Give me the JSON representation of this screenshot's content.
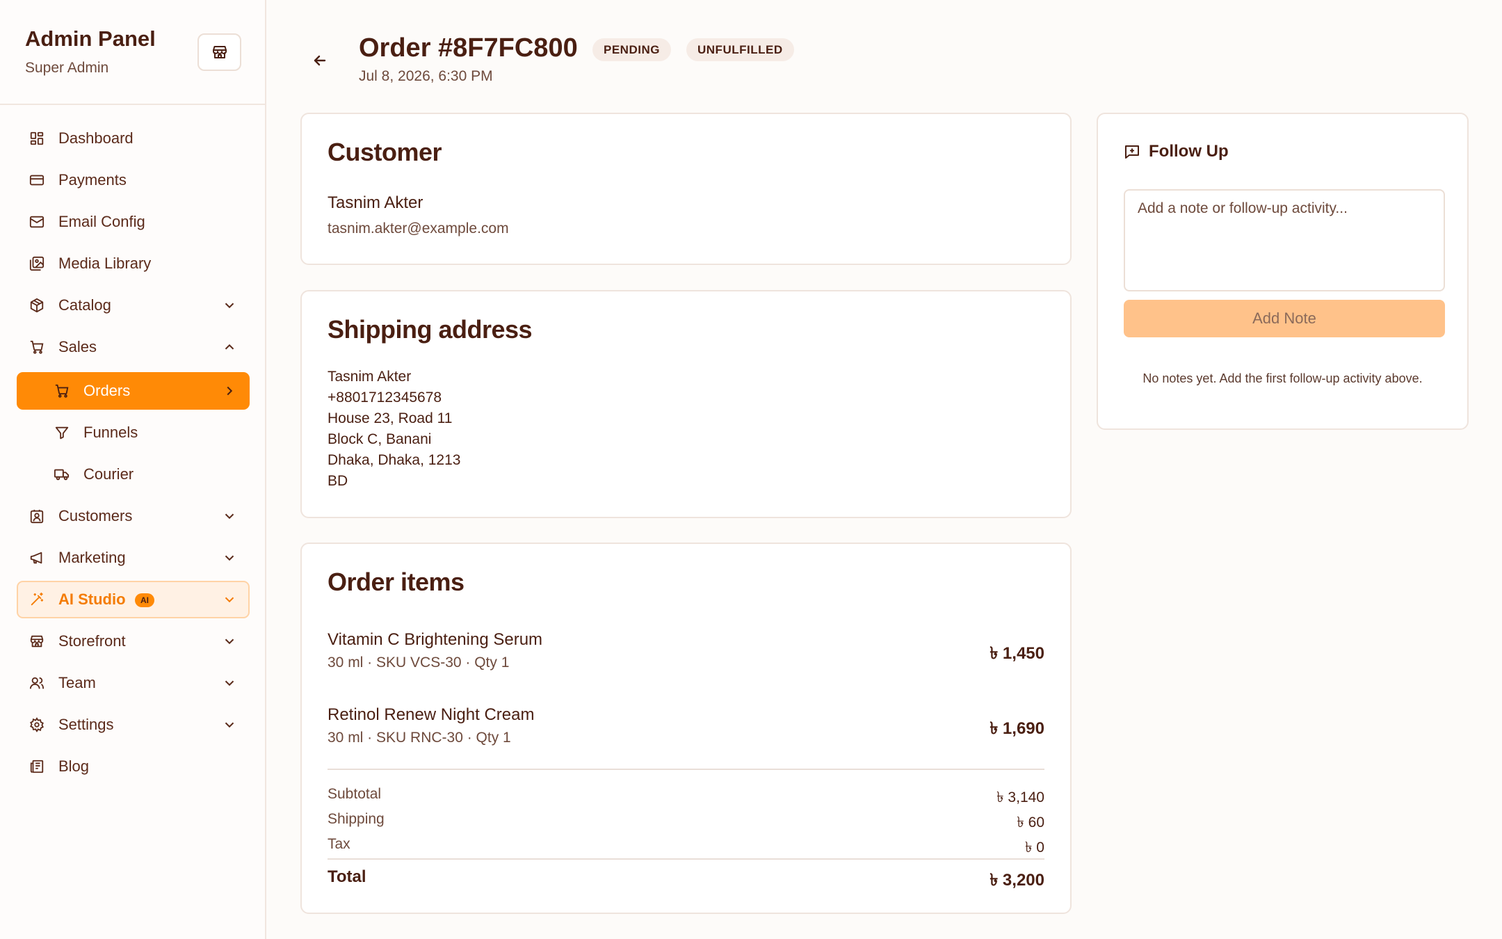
{
  "sidebar": {
    "title": "Admin Panel",
    "subtitle": "Super Admin",
    "items": [
      {
        "label": "Dashboard",
        "icon": "dashboard-icon"
      },
      {
        "label": "Payments",
        "icon": "credit-card-icon"
      },
      {
        "label": "Email Config",
        "icon": "mail-icon"
      },
      {
        "label": "Media Library",
        "icon": "images-icon"
      },
      {
        "label": "Catalog",
        "icon": "package-icon"
      },
      {
        "label": "Sales",
        "icon": "cart-icon"
      },
      {
        "label": "Orders",
        "icon": "cart-icon"
      },
      {
        "label": "Funnels",
        "icon": "funnel-icon"
      },
      {
        "label": "Courier",
        "icon": "truck-icon"
      },
      {
        "label": "Customers",
        "icon": "contact-icon"
      },
      {
        "label": "Marketing",
        "icon": "megaphone-icon"
      },
      {
        "label": "AI Studio",
        "icon": "wand-icon",
        "badge": "AI"
      },
      {
        "label": "Storefront",
        "icon": "store-icon"
      },
      {
        "label": "Team",
        "icon": "users-icon"
      },
      {
        "label": "Settings",
        "icon": "gear-icon"
      },
      {
        "label": "Blog",
        "icon": "newspaper-icon"
      }
    ]
  },
  "header": {
    "title": "Order #8F7FC800",
    "status_badge": "PENDING",
    "fulfillment_badge": "UNFULFILLED",
    "date": "Jul 8, 2026, 6:30 PM"
  },
  "customer": {
    "heading": "Customer",
    "name": "Tasnim Akter",
    "email": "tasnim.akter@example.com"
  },
  "shipping": {
    "heading": "Shipping address",
    "lines": [
      "Tasnim Akter",
      "+8801712345678",
      "House 23, Road 11",
      "Block C, Banani",
      "Dhaka, Dhaka, 1213",
      "BD"
    ]
  },
  "order_items": {
    "heading": "Order items",
    "items": [
      {
        "name": "Vitamin C Brightening Serum",
        "meta": "30 ml · SKU VCS-30 · Qty 1",
        "price": "৳ 1,450"
      },
      {
        "name": "Retinol Renew Night Cream",
        "meta": "30 ml · SKU RNC-30 · Qty 1",
        "price": "৳ 1,690"
      }
    ],
    "subtotal_label": "Subtotal",
    "subtotal": "৳ 3,140",
    "shipping_label": "Shipping",
    "shipping": "৳ 60",
    "tax_label": "Tax",
    "tax": "৳ 0",
    "total_label": "Total",
    "total": "৳ 3,200"
  },
  "follow_up": {
    "title": "Follow Up",
    "placeholder": "Add a note or follow-up activity...",
    "button": "Add Note",
    "empty": "No notes yet. Add the first follow-up activity above."
  },
  "colors": {
    "accent": "#ff8a06",
    "accent_soft": "#ffc28a",
    "text": "#4a1f12",
    "muted": "#6e4a3c"
  }
}
